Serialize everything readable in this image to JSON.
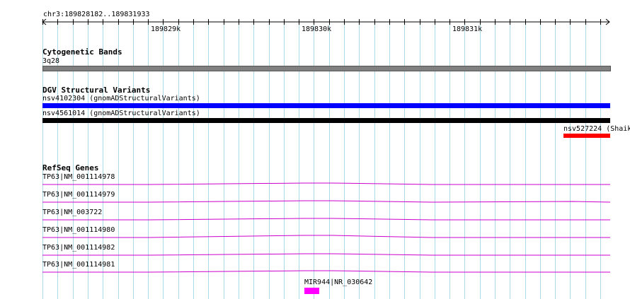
{
  "ruler": {
    "location": "chr3:189828182..189831933",
    "ticks": [
      "189829k",
      "189830k",
      "189831k"
    ]
  },
  "cytoband": {
    "title": "Cytogenetic Bands",
    "band": "3q28"
  },
  "dgv": {
    "title": "DGV Structural Variants",
    "items": [
      {
        "label": "nsv4102304 (gnomADStructuralVariants)",
        "color": "#0000ff"
      },
      {
        "label": "nsv4561014 (gnomADStructuralVariants)",
        "color": "#000000"
      },
      {
        "label": "nsv527224 (Shaik",
        "color": "#ff0000"
      }
    ]
  },
  "refseq": {
    "title": "RefSeq Genes",
    "transcripts": [
      "TP63|NM_001114978",
      "TP63|NM_001114979",
      "TP63|NM_003722",
      "TP63|NM_001114980",
      "TP63|NM_001114982",
      "TP63|NM_001114981"
    ],
    "mirna": "MIR944|NR_030642",
    "gene_color": "#cc00cc",
    "mirna_color": "#ff00ff"
  },
  "colors": {
    "grid_minor": "#add8e6",
    "cytoband_fill": "#808080",
    "axis": "#000000"
  }
}
